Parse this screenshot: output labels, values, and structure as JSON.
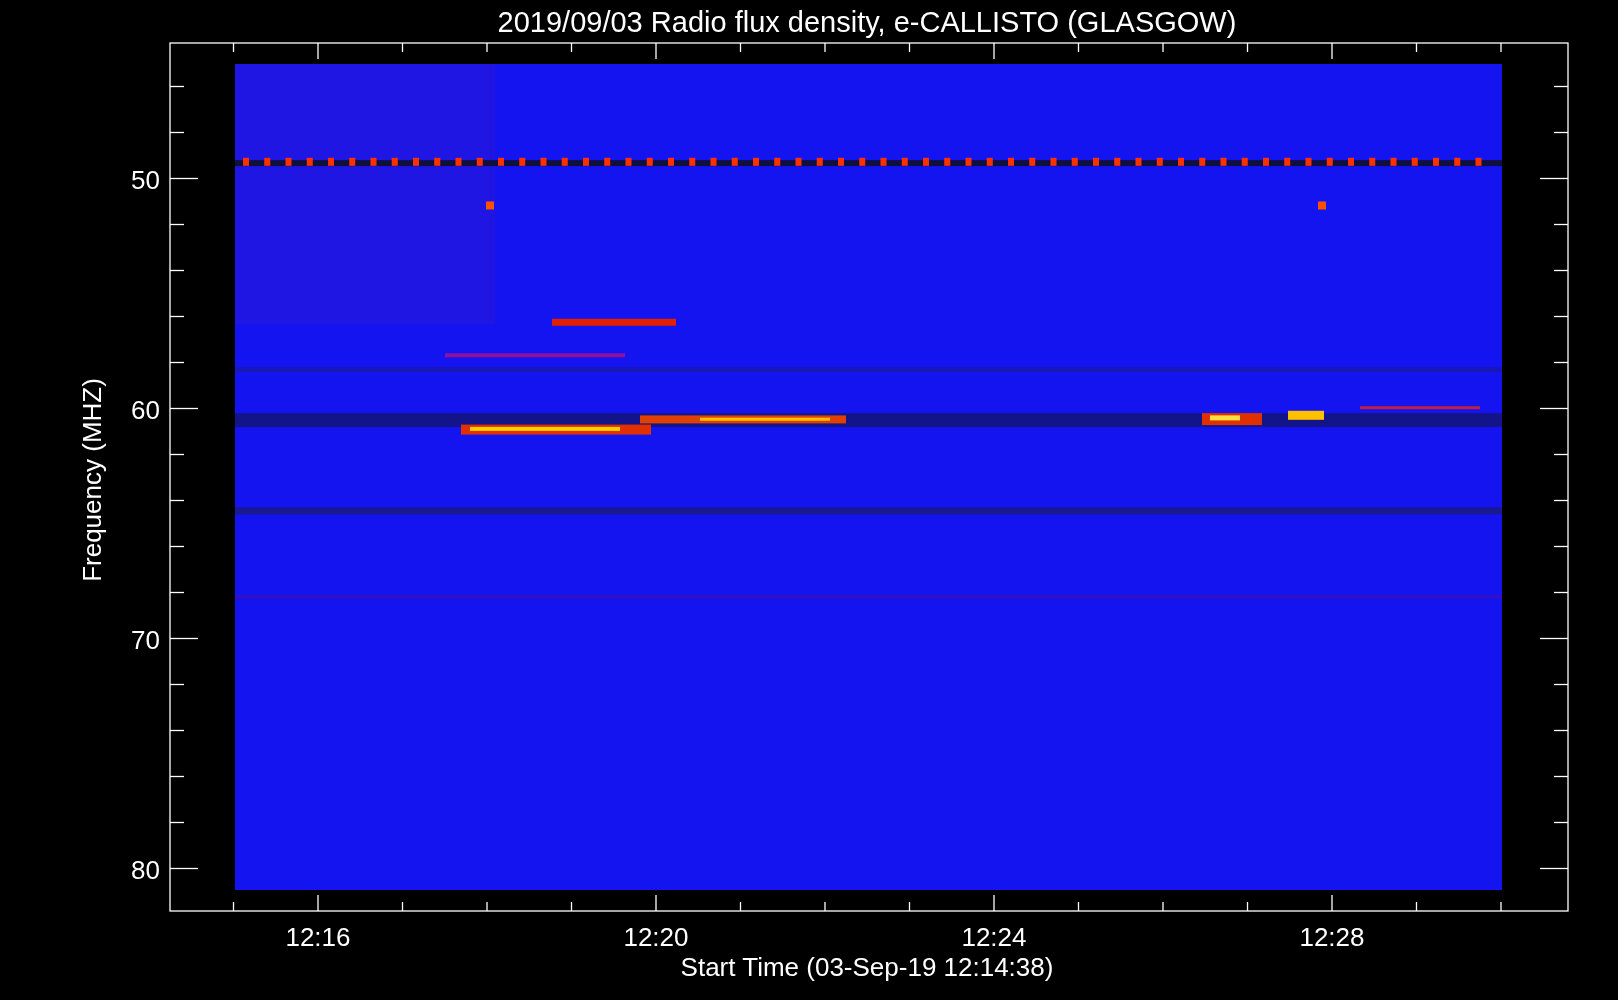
{
  "title": "2019/09/03  Radio flux density, e-CALLISTO (GLASGOW)",
  "x_axis": {
    "label": "Start Time (03-Sep-19 12:14:38)",
    "ticks": [
      "12:16",
      "12:20",
      "12:24",
      "12:28"
    ]
  },
  "y_axis": {
    "label": "Frequency (MHZ)",
    "ticks": [
      "50",
      "60",
      "70",
      "80"
    ]
  }
}
